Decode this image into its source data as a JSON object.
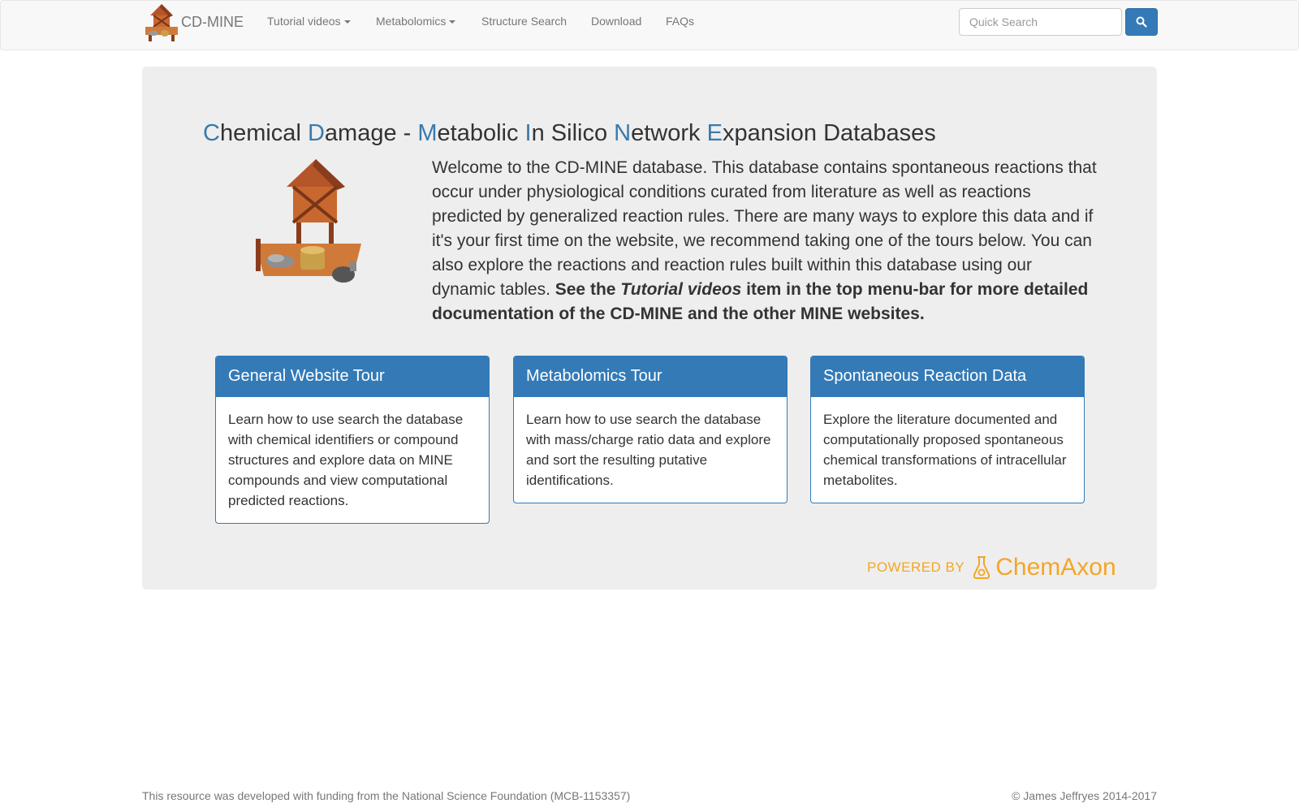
{
  "navbar": {
    "brand": "CD-MINE",
    "items": [
      {
        "label": "Tutorial videos",
        "dropdown": true
      },
      {
        "label": "Metabolomics",
        "dropdown": true
      },
      {
        "label": "Structure Search",
        "dropdown": false
      },
      {
        "label": "Download",
        "dropdown": false
      },
      {
        "label": "FAQs",
        "dropdown": false
      }
    ],
    "search_placeholder": "Quick Search",
    "search_button_icon": "search-icon"
  },
  "jumbotron": {
    "headline_parts": [
      {
        "accent": "C",
        "rest": "hemical "
      },
      {
        "accent": "D",
        "rest": "amage - "
      },
      {
        "accent": "M",
        "rest": "etabolic "
      },
      {
        "accent": "I",
        "rest": "n Silico "
      },
      {
        "accent": "N",
        "rest": "etwork "
      },
      {
        "accent": "E",
        "rest": "xpansion Databases"
      }
    ],
    "intro_text": "Welcome to the CD-MINE database. This database contains spontaneous reactions that occur under physiological conditions curated from literature as well as reactions predicted by generalized reaction rules. There are many ways to explore this data and if it's your first time on the website, we recommend taking one of the tours below. You can also explore the reactions and reaction rules built within this database using our dynamic tables.",
    "intro_bold_prefix": "See the",
    "intro_bold_italic": "Tutorial videos",
    "intro_bold_suffix": "item in the top menu-bar for more detailed documentation of the CD-MINE and the other MINE websites.",
    "panels": [
      {
        "title": "General Website Tour",
        "body": "Learn how to use search the database with chemical identifiers or compound structures and explore data on MINE compounds and view computational predicted reactions."
      },
      {
        "title": "Metabolomics Tour",
        "body": "Learn how to use search the database with mass/charge ratio data and explore and sort the resulting putative identifications."
      },
      {
        "title": "Spontaneous Reaction Data",
        "body": "Explore the literature documented and computationally proposed spontaneous chemical transformations of intracellular metabolites."
      }
    ],
    "powered_by": "POWERED BY",
    "powered_brand": "ChemAxon"
  },
  "footer": {
    "funding": "This resource was developed with funding from the National Science Foundation (MCB-1153357)",
    "copyright": "© James Jeffryes 2014-2017"
  },
  "colors": {
    "accent": "#337ab7",
    "chemaxon": "#f5a623"
  }
}
